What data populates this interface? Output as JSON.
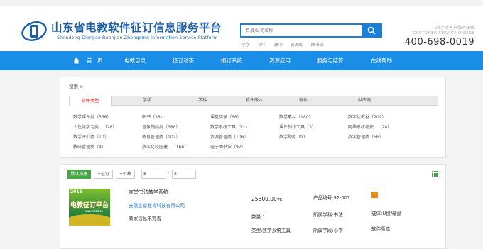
{
  "header": {
    "title": "山东省电教软件征订信息服务平台",
    "subtitle": "Shandong Dianjiao Ruanjian Zhengding Information Service Platform",
    "search_placeholder": "目录/公司名称",
    "hot_words": [
      "小学",
      "初中",
      "高中",
      "资源库",
      "图书馆"
    ],
    "hotline_label": "24小时客户服务热线",
    "hotline_label_en": "CUSTOMER SERVICE ONLINE",
    "hotline_number": "400-698-0019"
  },
  "nav": {
    "items": [
      "首　页",
      "电教目录",
      "征订动态",
      "报订系统",
      "资源应用",
      "服务与结算",
      "在线帮助"
    ]
  },
  "filter": {
    "breadcrumb": "搜索 >",
    "tabs": [
      "软件类型",
      "学段",
      "学科",
      "软件版本",
      "载体",
      "供应商"
    ],
    "categories": [
      "数学课件类（336）",
      "图书（35）",
      "课堂实录（68）",
      "数学素材（180）",
      "数字化教材（209）",
      "个性化学习类...（26）",
      "音像制品类（388）",
      "数学系统工具（51）",
      "课件制作工具（3）",
      "网络系统与安...（28）",
      "数学评价类（10）",
      "教育管理类（102）",
      "资源管理类（106）",
      "数学题库（9）",
      "数学管理类（56）",
      "教研管理类（4）",
      "数字化校园建...（166）",
      "电子图书馆（92）"
    ]
  },
  "list": {
    "sort_default": "默认排序",
    "sort_sales": "征订",
    "sort_price": "价格",
    "price_prefix": "¥",
    "price_sep": "-",
    "product": {
      "image_year": "2015",
      "image_brand": "电教征订平台",
      "image_url": "www.sdzd.cn",
      "name": "宣堂书法教学系统",
      "company": "安徽宣堂教育科技有限公司",
      "merchant_info": "商家信息未完善",
      "price": "25800.00元",
      "quantity": "数量:1",
      "type": "类型:数学系统工具",
      "code": "产品编号:92-001",
      "subject": "所属学科:书法",
      "stage": "所属学段:小学",
      "carrier": "载体:U盘/硬盘",
      "version": "软件版本:"
    }
  }
}
